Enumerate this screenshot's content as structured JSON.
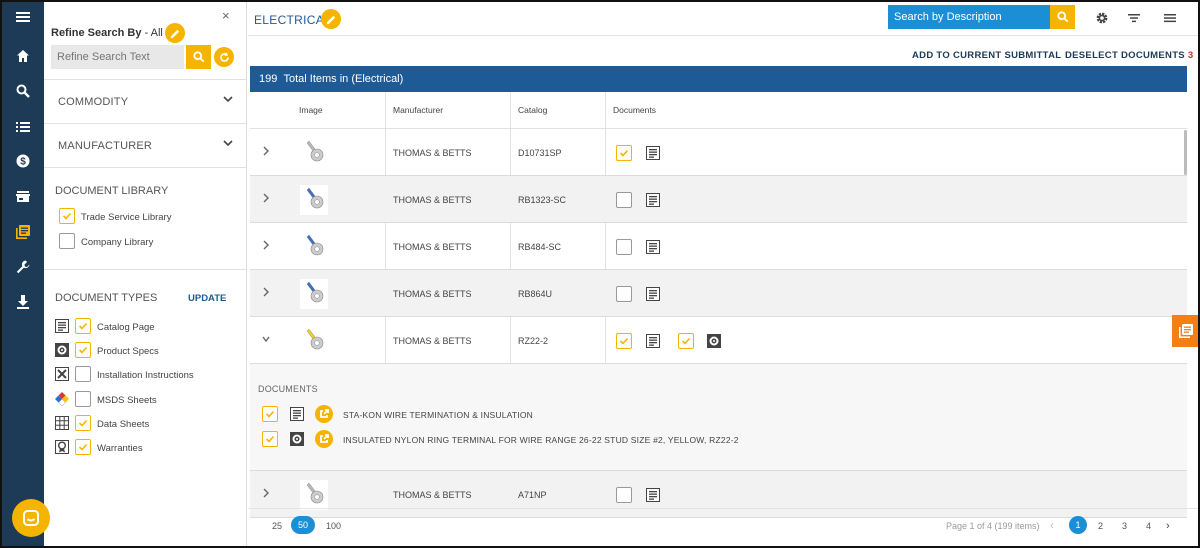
{
  "sidebar_rail": {
    "items": [
      {
        "name": "menu-icon"
      },
      {
        "name": "home-icon"
      },
      {
        "name": "search-icon"
      },
      {
        "name": "list-icon"
      },
      {
        "name": "dollar-icon"
      },
      {
        "name": "store-icon"
      },
      {
        "name": "library-icon",
        "active": true
      },
      {
        "name": "wrench-icon"
      },
      {
        "name": "download-icon"
      }
    ]
  },
  "refine": {
    "title": "Refine Search By",
    "title_suffix": " - All",
    "search_placeholder": "Refine Search Text",
    "accordions": [
      {
        "label": "COMMODITY"
      },
      {
        "label": "MANUFACTURER"
      }
    ],
    "document_library": {
      "heading": "DOCUMENT LIBRARY",
      "options": [
        {
          "label": "Trade Service Library",
          "checked": true
        },
        {
          "label": "Company Library",
          "checked": false
        }
      ]
    },
    "document_types": {
      "heading": "DOCUMENT TYPES",
      "update_label": "UPDATE",
      "options": [
        {
          "label": "Catalog Page",
          "icon": "catalog-page-icon",
          "checked": true
        },
        {
          "label": "Product Specs",
          "icon": "gear-icon",
          "checked": true
        },
        {
          "label": "Installation Instructions",
          "icon": "tools-icon",
          "checked": false
        },
        {
          "label": "MSDS Sheets",
          "icon": "msds-diamond-icon",
          "checked": false
        },
        {
          "label": "Data Sheets",
          "icon": "grid-icon",
          "checked": true
        },
        {
          "label": "Warranties",
          "icon": "ribbon-icon",
          "checked": true
        }
      ]
    }
  },
  "header": {
    "title": "ELECTRICAL",
    "search_placeholder": "Search by Description"
  },
  "actions": {
    "add_label": "ADD TO CURRENT SUBMITTAL",
    "deselect_label": "DESELECT DOCUMENTS",
    "deselect_count": "3"
  },
  "results": {
    "count": "199",
    "label": "Total Items in (Electrical)"
  },
  "table": {
    "columns": [
      "Image",
      "Manufacturer",
      "Catalog",
      "Documents"
    ],
    "rows": [
      {
        "manufacturer": "THOMAS & BETTS",
        "catalog": "D10731SP",
        "doc_checked": true,
        "color": "#b8b8b8"
      },
      {
        "manufacturer": "THOMAS & BETTS",
        "catalog": "RB1323-SC",
        "doc_checked": false,
        "color": "#3f6fc4"
      },
      {
        "manufacturer": "THOMAS & BETTS",
        "catalog": "RB484-SC",
        "doc_checked": false,
        "color": "#3f6fc4"
      },
      {
        "manufacturer": "THOMAS & BETTS",
        "catalog": "RB864U",
        "doc_checked": false,
        "color": "#3f6fc4"
      },
      {
        "manufacturer": "THOMAS & BETTS",
        "catalog": "RZ22-2",
        "doc_checked": true,
        "color": "#f0d020",
        "expanded": true
      },
      {
        "manufacturer": "THOMAS & BETTS",
        "catalog": "A71NP",
        "doc_checked": false,
        "color": "#b8b8b8"
      }
    ],
    "expanded_docs": {
      "heading": "DOCUMENTS",
      "items": [
        {
          "label": "STA-KON WIRE TERMINATION & INSULATION",
          "icon": "catalog-page-icon"
        },
        {
          "label": "INSULATED NYLON RING TERMINAL FOR WIRE RANGE 26-22 STUD SIZE #2, YELLOW, RZ22-2",
          "icon": "gear-icon"
        }
      ]
    }
  },
  "pager": {
    "sizes": [
      "25",
      "50",
      "100"
    ],
    "active_size": "50",
    "info": "Page 1 of 4 (199 items)",
    "pages": [
      "1",
      "2",
      "3",
      "4"
    ],
    "active_page": "1",
    "prev": "‹",
    "next": "›"
  },
  "colors": {
    "rail": "#1d3a57",
    "accent_yellow": "#f5b400",
    "primary_blue": "#1d5a96",
    "search_blue": "#1a8fd6",
    "orange_tab": "#f57f17"
  }
}
